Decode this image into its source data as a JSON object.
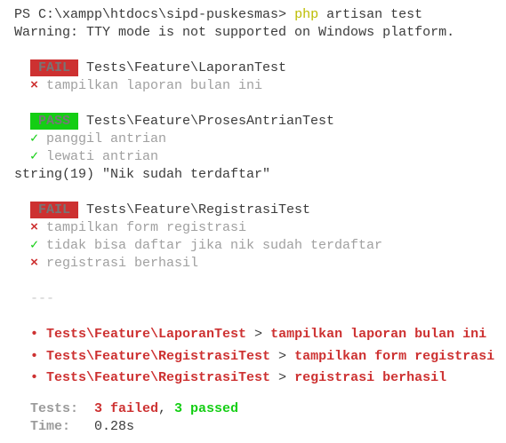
{
  "prompt": {
    "path": "PS C:\\xampp\\htdocs\\sipd-puskesmas> ",
    "cmd": "php",
    "args": " artisan test"
  },
  "warning": "Warning: TTY mode is not supported on Windows platform.",
  "suites": [
    {
      "status": "FAIL",
      "name": "Tests\\Feature\\LaporanTest",
      "tests": [
        {
          "ok": false,
          "mark": "×",
          "name": "tampilkan laporan bulan ini"
        }
      ]
    },
    {
      "status": "PASS",
      "name": "Tests\\Feature\\ProsesAntrianTest",
      "tests": [
        {
          "ok": true,
          "mark": "✓",
          "name": "panggil antrian"
        },
        {
          "ok": true,
          "mark": "✓",
          "name": "lewati antrian"
        }
      ]
    },
    {
      "status": "FAIL",
      "name": "Tests\\Feature\\RegistrasiTest",
      "tests": [
        {
          "ok": false,
          "mark": "×",
          "name": "tampilkan form registrasi"
        },
        {
          "ok": true,
          "mark": "✓",
          "name": "tidak bisa daftar jika nik sudah terdaftar"
        },
        {
          "ok": false,
          "mark": "×",
          "name": "registrasi berhasil"
        }
      ]
    }
  ],
  "dump": "string(19) \"Nik sudah terdaftar\"",
  "separator": "---",
  "failures": [
    {
      "bullet": "•",
      "class": "Tests\\Feature\\LaporanTest",
      "sep": " > ",
      "test": "tampilkan laporan bulan ini"
    },
    {
      "bullet": "•",
      "class": "Tests\\Feature\\RegistrasiTest",
      "sep": " > ",
      "test": "tampilkan form registrasi"
    },
    {
      "bullet": "•",
      "class": "Tests\\Feature\\RegistrasiTest",
      "sep": " > ",
      "test": "registrasi berhasil"
    }
  ],
  "summary": {
    "tests_label": "Tests:",
    "failed": "3 failed",
    "comma": ", ",
    "passed": "3 passed",
    "time_label": "Time:",
    "time": "0.28s"
  },
  "colors": {
    "fail": "#cd3131",
    "pass": "#14ce14",
    "command": "#bcbc00",
    "muted": "#a0a0a0",
    "text": "#3b3b3b"
  }
}
